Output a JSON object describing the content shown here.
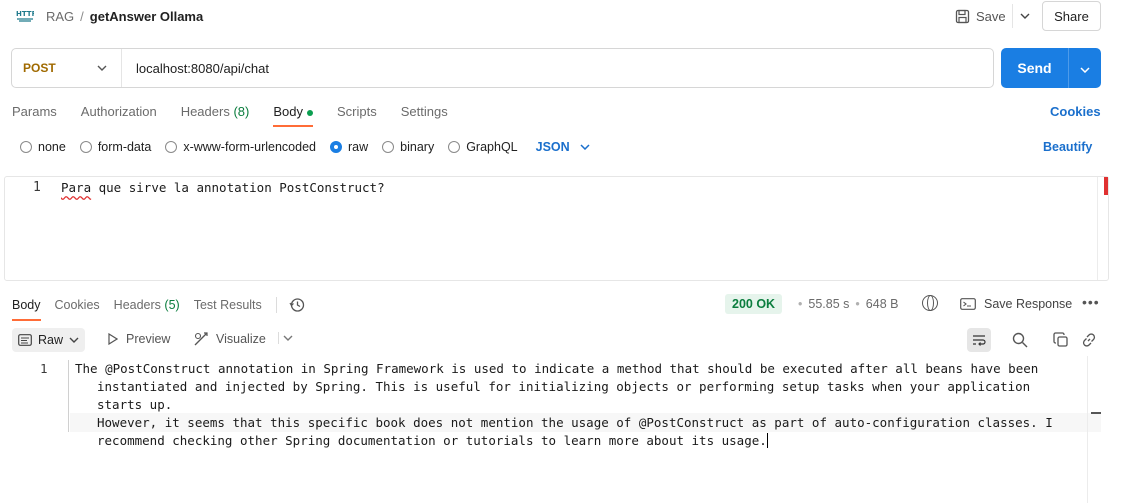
{
  "header": {
    "icon_label": "HTTP",
    "collection": "RAG",
    "separator": "/",
    "request_name": "getAnswer Ollama",
    "save_label": "Save",
    "share_label": "Share"
  },
  "request": {
    "method": "POST",
    "url": "localhost:8080/api/chat",
    "send_label": "Send"
  },
  "request_tabs": [
    {
      "label": "Params",
      "count": ""
    },
    {
      "label": "Authorization",
      "count": ""
    },
    {
      "label": "Headers",
      "count": "(8)"
    },
    {
      "label": "Body",
      "count": ""
    },
    {
      "label": "Scripts",
      "count": ""
    },
    {
      "label": "Settings",
      "count": ""
    }
  ],
  "cookies_label": "Cookies",
  "body_types": [
    {
      "label": "none",
      "selected": false
    },
    {
      "label": "form-data",
      "selected": false
    },
    {
      "label": "x-www-form-urlencoded",
      "selected": false
    },
    {
      "label": "raw",
      "selected": true
    },
    {
      "label": "binary",
      "selected": false
    },
    {
      "label": "GraphQL",
      "selected": false
    }
  ],
  "format_label": "JSON",
  "beautify_label": "Beautify",
  "request_body": {
    "line_number": "1",
    "first_word": "Para",
    "rest": " que sirve la annotation PostConstruct?"
  },
  "response_tabs": [
    {
      "label": "Body",
      "count": ""
    },
    {
      "label": "Cookies",
      "count": ""
    },
    {
      "label": "Headers",
      "count": "(5)"
    },
    {
      "label": "Test Results",
      "count": ""
    }
  ],
  "response_meta": {
    "status": "200 OK",
    "time": "55.85 s",
    "size": "648 B",
    "save_response_label": "Save Response"
  },
  "response_toolbar": {
    "raw_label": "Raw",
    "preview_label": "Preview",
    "visualize_label": "Visualize"
  },
  "response_body": {
    "line_number": "1",
    "lines": [
      "The @PostConstruct annotation in Spring Framework is used to indicate a method that should be executed after all beans have been",
      "instantiated and injected by Spring. This is useful for initializing objects or performing setup tasks when your application starts up.",
      "However, it seems that this specific book does not mention the usage of @PostConstruct as part of auto-configuration classes. I",
      "recommend checking other Spring documentation or tutorials to learn more about its usage."
    ]
  },
  "colors": {
    "accent": "#1a7ee3",
    "tab_underline": "#ff6c37",
    "status_ok": "#0b7d3e",
    "method_post": "#a06a00"
  }
}
